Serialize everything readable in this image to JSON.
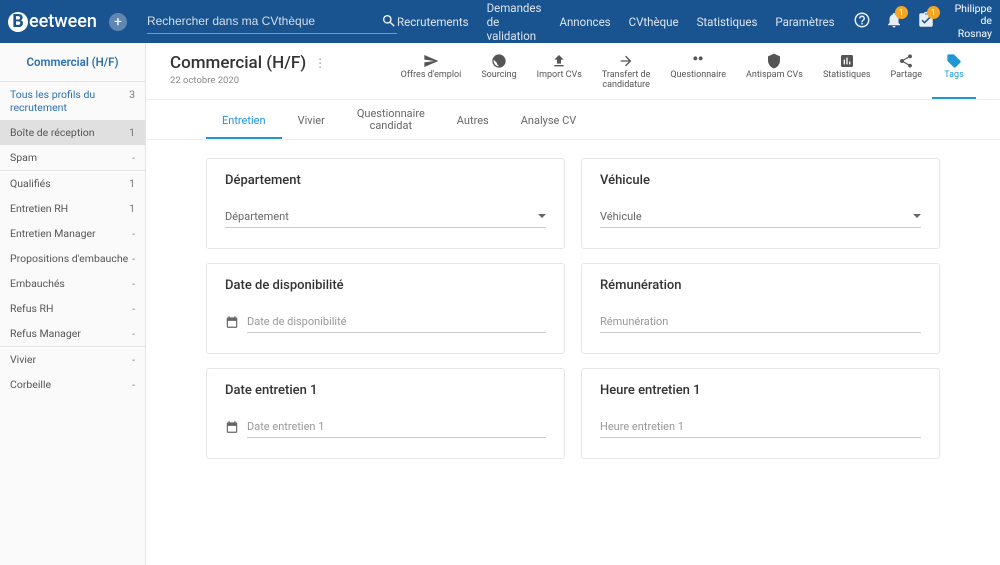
{
  "header": {
    "logo": "eetween",
    "search_placeholder": "Rechercher dans ma CVthèque",
    "nav": [
      "Recrutements",
      "Demandes de validation",
      "Annonces",
      "CVthèque",
      "Statistiques",
      "Paramètres"
    ],
    "notif_badge": "1",
    "task_badge": "1",
    "user_first": "Philippe",
    "user_last": "de Rosnay"
  },
  "sidebar": {
    "title": "Commercial (H/F)",
    "items": [
      {
        "label": "Tous les profils du recrutement",
        "count": "3",
        "cls": "blue"
      },
      {
        "label": "Boîte de réception",
        "count": "1",
        "cls": "active"
      },
      {
        "label": "Spam",
        "count": "-",
        "cls": ""
      },
      {
        "divider": true
      },
      {
        "label": "Qualifiés",
        "count": "1",
        "cls": ""
      },
      {
        "label": "Entretien RH",
        "count": "1",
        "cls": ""
      },
      {
        "label": "Entretien Manager",
        "count": "-",
        "cls": ""
      },
      {
        "label": "Propositions d'embauche",
        "count": "-",
        "cls": ""
      },
      {
        "label": "Embauchés",
        "count": "-",
        "cls": ""
      },
      {
        "label": "Refus RH",
        "count": "-",
        "cls": ""
      },
      {
        "label": "Refus Manager",
        "count": "-",
        "cls": ""
      },
      {
        "divider": true
      },
      {
        "label": "Vivier",
        "count": "-",
        "cls": ""
      },
      {
        "label": "Corbeille",
        "count": "-",
        "cls": ""
      }
    ]
  },
  "page": {
    "title": "Commercial (H/F)",
    "date": "22 octobre 2020"
  },
  "actions": [
    {
      "label": "Offres d'emploi"
    },
    {
      "label": "Sourcing"
    },
    {
      "label": "Import CVs"
    },
    {
      "label": "Transfert de\ncandidature"
    },
    {
      "label": "Questionnaire"
    },
    {
      "label": "Antispam CVs"
    },
    {
      "label": "Statistiques"
    },
    {
      "label": "Partage"
    },
    {
      "label": "Tags"
    }
  ],
  "tabs": [
    {
      "label": "Entretien",
      "active": true
    },
    {
      "label": "Vivier"
    },
    {
      "label": "Questionnaire\ncandidat",
      "multiline": true
    },
    {
      "label": "Autres"
    },
    {
      "label": "Analyse CV"
    }
  ],
  "cards": {
    "departement": {
      "title": "Département",
      "field": "Département"
    },
    "vehicule": {
      "title": "Véhicule",
      "field": "Véhicule"
    },
    "dispo": {
      "title": "Date de disponibilité",
      "field": "Date de disponibilité"
    },
    "remun": {
      "title": "Rémunération",
      "field": "Rémunération"
    },
    "date1": {
      "title": "Date entretien 1",
      "field": "Date entretien 1"
    },
    "heure1": {
      "title": "Heure entretien 1",
      "field": "Heure entretien 1"
    }
  }
}
